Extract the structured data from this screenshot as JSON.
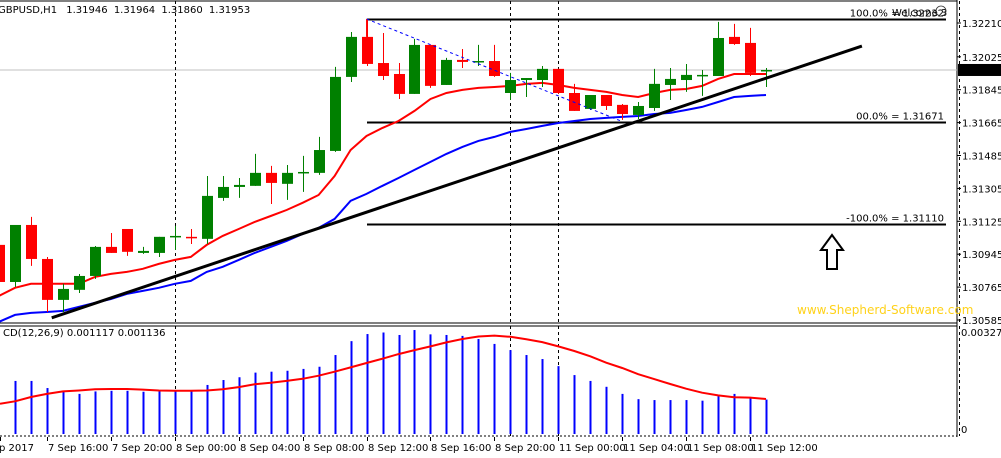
{
  "chart_data": {
    "type": "candlestick",
    "symbol_header": {
      "symbol": "GBPUSD,H1",
      "open": "1.31946",
      "high": "1.31964",
      "low": "1.31860",
      "close": "1.31953"
    },
    "current_price": "1.31953",
    "price_ticks": [
      "1.32210",
      "1.32025",
      "1.31845",
      "1.31665",
      "1.31485",
      "1.31305",
      "1.31125",
      "1.30945",
      "1.30765",
      "1.30585"
    ],
    "ylim": [
      1.30585,
      1.3221
    ],
    "candles_ohlc": [
      [
        1.30996,
        1.31007,
        1.30783,
        1.30793
      ],
      [
        1.30793,
        1.31105,
        1.30766,
        1.31105
      ],
      [
        1.31105,
        1.31149,
        1.30881,
        1.30919
      ],
      [
        1.30919,
        1.3093,
        1.30629,
        1.30695
      ],
      [
        1.30695,
        1.30783,
        1.30629,
        1.30755
      ],
      [
        1.3075,
        1.30837,
        1.30733,
        1.30826
      ],
      [
        1.30826,
        1.3099,
        1.3081,
        1.30985
      ],
      [
        1.30985,
        1.31061,
        1.30952,
        1.30952
      ],
      [
        1.31083,
        1.31083,
        1.30936,
        1.30958
      ],
      [
        1.30952,
        1.30985,
        1.30947,
        1.30963
      ],
      [
        1.30952,
        1.3104,
        1.3093,
        1.3104
      ],
      [
        1.3104,
        1.311,
        1.30968,
        1.31045
      ],
      [
        1.3104,
        1.31083,
        1.31001,
        1.31034
      ],
      [
        1.31029,
        1.31373,
        1.31001,
        1.31264
      ],
      [
        1.31253,
        1.31373,
        1.31237,
        1.31313
      ],
      [
        1.31313,
        1.31362,
        1.31253,
        1.31324
      ],
      [
        1.31319,
        1.31494,
        1.31319,
        1.3139
      ],
      [
        1.3139,
        1.31428,
        1.3122,
        1.31335
      ],
      [
        1.3133,
        1.31433,
        1.31242,
        1.3139
      ],
      [
        1.3139,
        1.31483,
        1.31286,
        1.31395
      ],
      [
        1.3139,
        1.31587,
        1.31379,
        1.31515
      ],
      [
        1.3151,
        1.3197,
        1.31505,
        1.31915
      ],
      [
        1.31915,
        1.32161,
        1.31887,
        1.32134
      ],
      [
        1.32134,
        1.32232,
        1.31975,
        1.31986
      ],
      [
        1.31991,
        1.32155,
        1.31898,
        1.3192
      ],
      [
        1.31931,
        1.31991,
        1.31794,
        1.31822
      ],
      [
        1.31822,
        1.32123,
        1.31822,
        1.3209
      ],
      [
        1.3209,
        1.3209,
        1.31855,
        1.31866
      ],
      [
        1.31871,
        1.32019,
        1.31871,
        1.32008
      ],
      [
        1.32008,
        1.32068,
        1.31964,
        1.31997
      ],
      [
        1.31997,
        1.3209,
        1.31975,
        1.32002
      ],
      [
        1.32002,
        1.3209,
        1.31915,
        1.3192
      ],
      [
        1.31827,
        1.31937,
        1.31789,
        1.31898
      ],
      [
        1.31898,
        1.31909,
        1.31805,
        1.31909
      ],
      [
        1.31898,
        1.31975,
        1.3186,
        1.31959
      ],
      [
        1.31959,
        1.31959,
        1.31822,
        1.31827
      ],
      [
        1.31827,
        1.31877,
        1.31729,
        1.31729
      ],
      [
        1.3174,
        1.31816,
        1.31734,
        1.31816
      ],
      [
        1.31816,
        1.31816,
        1.31734,
        1.31756
      ],
      [
        1.31762,
        1.31767,
        1.3168,
        1.31712
      ],
      [
        1.31707,
        1.31778,
        1.31685,
        1.31756
      ],
      [
        1.31745,
        1.31959,
        1.31729,
        1.31877
      ],
      [
        1.31871,
        1.31964,
        1.31789,
        1.31904
      ],
      [
        1.31898,
        1.31986,
        1.31833,
        1.31926
      ],
      [
        1.3192,
        1.31953,
        1.31811,
        1.31926
      ],
      [
        1.3192,
        1.32216,
        1.3192,
        1.32128
      ],
      [
        1.32134,
        1.32205,
        1.3209,
        1.32095
      ],
      [
        1.32101,
        1.32183,
        1.3192,
        1.31937
      ],
      [
        1.31946,
        1.31964,
        1.3186,
        1.31953
      ]
    ],
    "ma_fast": [
      1.30717,
      1.30761,
      1.30783,
      1.30783,
      1.30783,
      1.30783,
      1.30821,
      1.30837,
      1.30848,
      1.30865,
      1.30892,
      1.30914,
      1.3093,
      1.30996,
      1.31045,
      1.31083,
      1.31122,
      1.31154,
      1.31187,
      1.31226,
      1.31269,
      1.31373,
      1.31515,
      1.31592,
      1.31636,
      1.31674,
      1.31729,
      1.31794,
      1.31827,
      1.31844,
      1.31855,
      1.3186,
      1.31866,
      1.31877,
      1.31882,
      1.31871,
      1.31855,
      1.31844,
      1.31833,
      1.31816,
      1.31805,
      1.31827,
      1.31844,
      1.31849,
      1.31866,
      1.31904,
      1.31931,
      1.31931,
      1.31931
    ],
    "ma_slow": [
      1.30575,
      1.30613,
      1.30624,
      1.30629,
      1.30635,
      1.30657,
      1.30679,
      1.307,
      1.30728,
      1.30744,
      1.30761,
      1.30783,
      1.30799,
      1.30848,
      1.30876,
      1.30914,
      1.30952,
      1.30985,
      1.31018,
      1.31056,
      1.31089,
      1.31138,
      1.31237,
      1.31275,
      1.31319,
      1.31362,
      1.31406,
      1.3145,
      1.31494,
      1.31532,
      1.31565,
      1.31587,
      1.31614,
      1.3163,
      1.31647,
      1.31663,
      1.31674,
      1.31685,
      1.31691,
      1.31696,
      1.31701,
      1.31712,
      1.31718,
      1.31734,
      1.31751,
      1.31778,
      1.31805,
      1.31811,
      1.31816
    ],
    "trendline": {
      "start": {
        "bar": 3.3,
        "price": 1.30597
      },
      "end": {
        "bar": 54.0,
        "price": 1.32084
      }
    },
    "retrace_line": {
      "start": {
        "bar": 23,
        "price": 1.32232
      },
      "end": {
        "bar": 39,
        "price": 1.31671
      }
    },
    "fib_levels": [
      {
        "price": 1.32232,
        "label": "100.0% = 1.32232"
      },
      {
        "price": 1.31671,
        "label": "00.0% = 1.31671"
      },
      {
        "price": 1.3111,
        "label": "-100.0% = 1.31110"
      }
    ],
    "period_separators_bar": [
      11,
      32,
      35,
      60.1
    ],
    "macd": {
      "label": "CD(12,26,9) 0.001117 0.001136",
      "max_label": "0.003274",
      "zero_label": "0",
      "ylim": [
        0,
        0.003274
      ],
      "first_bar": 1,
      "histogram": [
        0.00172,
        0.00172,
        0.00149,
        0.0014,
        0.0013,
        0.00138,
        0.0014,
        0.0014,
        0.00137,
        0.0014,
        0.0014,
        0.0014,
        0.00159,
        0.00175,
        0.00184,
        0.00199,
        0.00202,
        0.00205,
        0.00211,
        0.00218,
        0.00256,
        0.00301,
        0.00324,
        0.00329,
        0.00321,
        0.00337,
        0.00323,
        0.00321,
        0.00318,
        0.00308,
        0.00292,
        0.00272,
        0.00256,
        0.00243,
        0.0022,
        0.00191,
        0.00172,
        0.00153,
        0.0013,
        0.00113,
        0.0011,
        0.0011,
        0.0011,
        0.00108,
        0.00123,
        0.0013,
        0.00119,
        0.001117
      ],
      "signal": [
        0.00106,
        0.0012,
        0.0013,
        0.00138,
        0.00141,
        0.00145,
        0.00146,
        0.00146,
        0.00144,
        0.00141,
        0.0014,
        0.0014,
        0.00141,
        0.00145,
        0.00152,
        0.00161,
        0.00166,
        0.00172,
        0.00179,
        0.00189,
        0.00202,
        0.00216,
        0.0023,
        0.00244,
        0.00259,
        0.00272,
        0.00284,
        0.00297,
        0.00308,
        0.00316,
        0.00319,
        0.00315,
        0.00307,
        0.00298,
        0.00284,
        0.00269,
        0.00252,
        0.00231,
        0.00214,
        0.00194,
        0.00178,
        0.00162,
        0.00147,
        0.00134,
        0.00125,
        0.00119,
        0.00118,
        0.001136
      ]
    },
    "time_labels": [
      {
        "bar": 0,
        "text": "p 2017"
      },
      {
        "bar": 3,
        "text": "7 Sep 16:00"
      },
      {
        "bar": 7,
        "text": "7 Sep 20:00"
      },
      {
        "bar": 11,
        "text": "8 Sep 00:00"
      },
      {
        "bar": 15,
        "text": "8 Sep 04:00"
      },
      {
        "bar": 19,
        "text": "8 Sep 08:00"
      },
      {
        "bar": 23,
        "text": "8 Sep 12:00"
      },
      {
        "bar": 27,
        "text": "8 Sep 16:00"
      },
      {
        "bar": 31,
        "text": "8 Sep 20:00"
      },
      {
        "bar": 35,
        "text": "11 Sep 00:00"
      },
      {
        "bar": 39,
        "text": "11 Sep 04:00"
      },
      {
        "bar": 43,
        "text": "11 Sep 08:00"
      },
      {
        "bar": 47,
        "text": "11 Sep 12:00"
      }
    ],
    "watermark": "www.Shepherd-Software.com",
    "welcome": "Welcome 3",
    "colors": {
      "bull": "#008000",
      "bear": "#ff0000",
      "ma_fast": "#ff0000",
      "ma_slow": "#0000ff",
      "histogram": "#0000ff",
      "signal": "#ff0000",
      "watermark": "#ffd21a",
      "grid_price": "#c0c0c0"
    }
  }
}
